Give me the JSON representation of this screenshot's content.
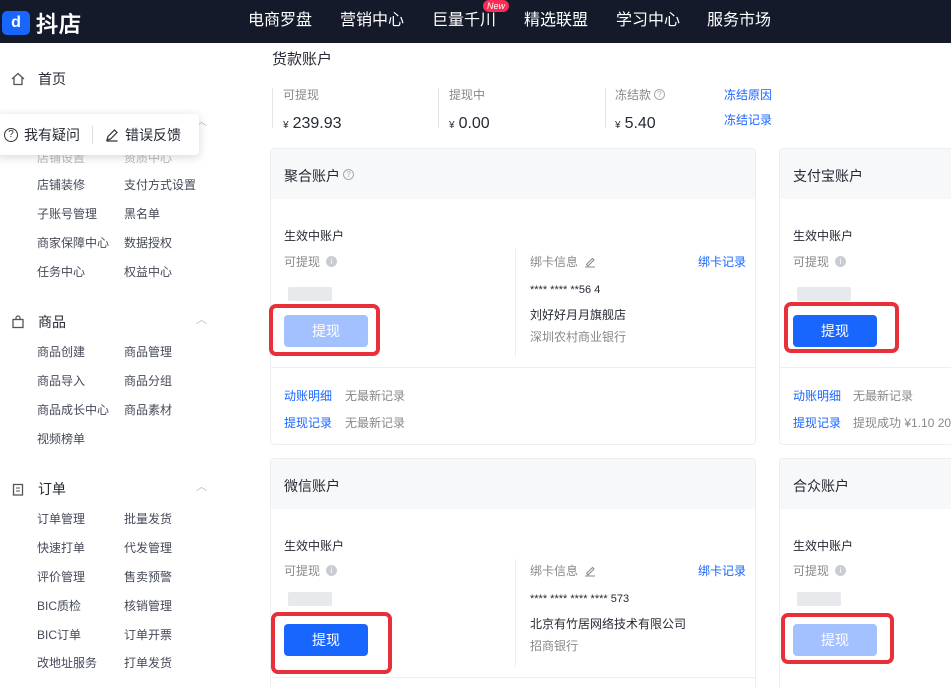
{
  "brand": {
    "logo_glyph": "d",
    "name": "抖店"
  },
  "topnav": {
    "items": [
      "电商罗盘",
      "营销中心",
      "巨量千川",
      "精选联盟",
      "学习中心",
      "服务市场"
    ],
    "badge": "New"
  },
  "sidebar": {
    "home": "首页",
    "popup": {
      "question": "我有疑问",
      "feedback": "错误反馈"
    },
    "store_items": [
      "店铺设置",
      "资质中心",
      "店铺装修",
      "支付方式设置",
      "子账号管理",
      "黑名单",
      "商家保障中心",
      "数据授权",
      "任务中心",
      "权益中心"
    ],
    "goods": {
      "title": "商品",
      "items": [
        "商品创建",
        "商品管理",
        "商品导入",
        "商品分组",
        "商品成长中心",
        "商品素材",
        "视频榜单"
      ]
    },
    "orders": {
      "title": "订单",
      "items": [
        "订单管理",
        "批量发货",
        "快速打单",
        "代发管理",
        "评价管理",
        "售卖预警",
        "BIC质检",
        "核销管理",
        "BIC订单",
        "订单开票",
        "改地址服务",
        "打单发货"
      ]
    }
  },
  "page": {
    "title": "货款账户",
    "balances": [
      {
        "label": "可提现",
        "currency": "¥",
        "value": "239.93"
      },
      {
        "label": "提现中",
        "currency": "¥",
        "value": "0.00"
      },
      {
        "label": "冻结款",
        "currency": "¥",
        "value": "5.40"
      }
    ],
    "freeze_links": {
      "reason": "冻结原因",
      "record": "冻结记录"
    }
  },
  "cards": {
    "juhe": {
      "title": "聚合账户",
      "active": "生效中账户",
      "withdrawable": "可提现",
      "bind_label": "绑卡信息",
      "bind_record": "绑卡记录",
      "card_no": "**** **** **56 4",
      "holder": "刘好好月月旗舰店",
      "bank": "深圳农村商业银行",
      "button": "提现",
      "flow_label": "动账明细",
      "flow_value": "无最新记录",
      "withdraw_label": "提现记录",
      "withdraw_value": "无最新记录"
    },
    "alipay": {
      "title": "支付宝账户",
      "active": "生效中账户",
      "withdrawable": "可提现",
      "button": "提现",
      "flow_label": "动账明细",
      "flow_value": "无最新记录",
      "withdraw_label": "提现记录",
      "withdraw_value": "提现成功 ¥1.10  20"
    },
    "wechat": {
      "title": "微信账户",
      "active": "生效中账户",
      "withdrawable": "可提现",
      "bind_label": "绑卡信息",
      "bind_record": "绑卡记录",
      "card_no": "**** **** **** **** 573",
      "holder": "北京有竹居网络技术有限公司",
      "bank": "招商银行",
      "button": "提现"
    },
    "hezhong": {
      "title": "合众账户",
      "active": "生效中账户",
      "withdrawable": "可提现",
      "button": "提现"
    }
  },
  "colors": {
    "accent": "#1966ff",
    "accent_disabled": "#a3c1ff",
    "highlight": "#e8303a",
    "topbar": "#141a2a"
  }
}
